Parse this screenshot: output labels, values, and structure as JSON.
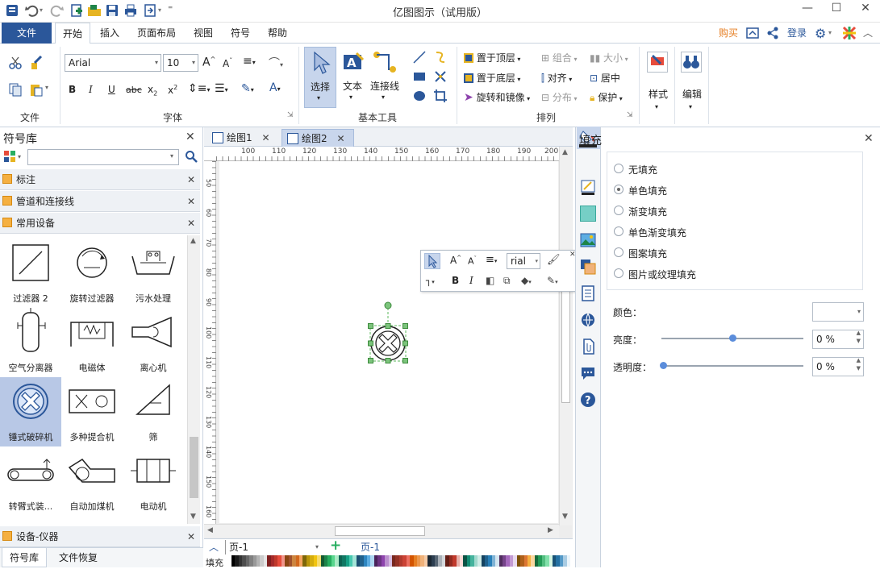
{
  "window": {
    "title": "亿图图示（试用版）"
  },
  "menu": {
    "file": "文件",
    "tabs": [
      "开始",
      "插入",
      "页面布局",
      "视图",
      "符号",
      "帮助"
    ]
  },
  "topright": {
    "buy": "购买",
    "login": "登录"
  },
  "ribbon": {
    "groups": {
      "file": "文件",
      "font": "字体",
      "basic_tools": "基本工具",
      "arrange": "排列"
    },
    "font_name": "Arial",
    "font_size": "10",
    "tools": {
      "select": "选择",
      "text": "文本",
      "connector": "连接线"
    },
    "arrange": {
      "bring_front": "置于顶层",
      "send_back": "置于底层",
      "rotate": "旋转和镜像",
      "group": "组合",
      "align": "对齐",
      "distribute": "分布",
      "size": "大小",
      "center": "居中",
      "protect": "保护"
    },
    "style": "样式",
    "edit": "编辑"
  },
  "library": {
    "title": "符号库",
    "search_placeholder": "",
    "sections": [
      "标注",
      "管道和连接线",
      "常用设备"
    ],
    "items": [
      "过滤器 2",
      "旋转过滤器",
      "污水处理",
      "空气分离器",
      "电磁体",
      "离心机",
      "锤式破碎机",
      "多种提合机",
      "筛",
      "转臂式装...",
      "自动加煤机",
      "电动机"
    ],
    "selected_index": 6,
    "bottom_section": "设备-仪器",
    "bottom_tabs": [
      "符号库",
      "文件恢复"
    ]
  },
  "docs": {
    "tabs": [
      "绘图1",
      "绘图2"
    ],
    "active": 1
  },
  "ruler": {
    "h": [
      "100",
      "110",
      "120",
      "130",
      "140",
      "150",
      "160",
      "170",
      "180",
      "190",
      "200"
    ],
    "v": [
      "50",
      "60",
      "70",
      "80",
      "90",
      "100",
      "110",
      "120",
      "130",
      "140",
      "150",
      "160"
    ]
  },
  "mini_toolbar": {
    "font": "rial"
  },
  "pages": {
    "current": "页-1",
    "tab": "页-1",
    "fill_label": "填充"
  },
  "fill_panel": {
    "title": "填充",
    "options": [
      "无填充",
      "单色填充",
      "渐变填充",
      "单色渐变填充",
      "图案填充",
      "图片或纹理填充"
    ],
    "selected": 1,
    "color_label": "颜色：",
    "brightness_label": "亮度：",
    "brightness_value": "0 %",
    "transparency_label": "透明度：",
    "transparency_value": "0 %",
    "brightness_level": 0.5,
    "transparency_level": 0
  },
  "colors": {
    "accent": "#2b579a",
    "orange": "#e67e22",
    "selection": "#b8c8e6",
    "handle": "#5cb85c"
  },
  "palette": [
    "#000000",
    "#1a1a1a",
    "#333333",
    "#4d4d4d",
    "#666666",
    "#808080",
    "#999999",
    "#b3b3b3",
    "#cccccc",
    "#e6e6e6",
    "#7f1f1f",
    "#a52a2a",
    "#c0392b",
    "#e74c3c",
    "#f1948a",
    "#8b4513",
    "#a0522d",
    "#cd853f",
    "#d2691e",
    "#f4a460",
    "#7d6608",
    "#b7950b",
    "#d4ac0d",
    "#f1c40f",
    "#f7dc6f",
    "#145a32",
    "#1e8449",
    "#27ae60",
    "#58d68d",
    "#abebc6",
    "#0e6251",
    "#117864",
    "#16a085",
    "#48c9b0",
    "#a3e4d7",
    "#1b4f72",
    "#21618c",
    "#2e86c1",
    "#5dade2",
    "#aed6f1",
    "#4a235a",
    "#6c3483",
    "#8e44ad",
    "#bb8fce",
    "#d7bde2",
    "#78281f",
    "#943126",
    "#b03a2e",
    "#cb4335",
    "#ec7063",
    "#d35400",
    "#e67e22",
    "#eb984e",
    "#f0b27a",
    "#f5cba7",
    "#1c2833",
    "#2c3e50",
    "#566573",
    "#abb2b9",
    "#d5d8dc",
    "#641e16",
    "#922b21",
    "#c0392b",
    "#e6b0aa",
    "#fadbd8",
    "#0b5345",
    "#138d75",
    "#45b39d",
    "#a2d9ce",
    "#d0ece7",
    "#154360",
    "#1f618d",
    "#2980b9",
    "#7fb3d5",
    "#d4e6f1",
    "#512e5f",
    "#76448a",
    "#a569bd",
    "#c39bd3",
    "#e8daef",
    "#7e5109",
    "#af601a",
    "#dc7633",
    "#f5b041",
    "#fad7a0",
    "#186a3b",
    "#239b56",
    "#52be80",
    "#82e0aa",
    "#d5f5e3",
    "#1a5276",
    "#2471a3",
    "#5499c7",
    "#a9cce3",
    "#ebf5fb"
  ]
}
